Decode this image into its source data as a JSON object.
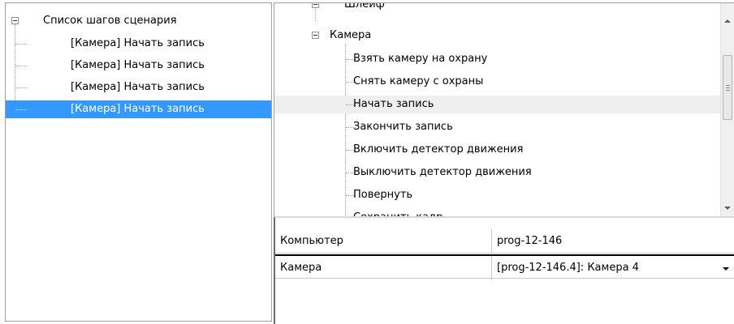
{
  "scenario_tree": {
    "root_label": "Список шагов сценария",
    "steps": [
      {
        "label": "[Камера] Начать запись",
        "selected": false
      },
      {
        "label": "[Камера] Начать запись",
        "selected": false
      },
      {
        "label": "[Камера] Начать запись",
        "selected": false
      },
      {
        "label": "[Камера] Начать запись",
        "selected": true
      }
    ]
  },
  "action_tree": {
    "partial_top_label": "Шлейф",
    "group_label": "Камера",
    "items": [
      {
        "label": "Взять камеру на охрану"
      },
      {
        "label": "Снять камеру с охраны"
      },
      {
        "label": "Начать запись",
        "highlighted": true
      },
      {
        "label": "Закончить запись"
      },
      {
        "label": "Включить детектор движения"
      },
      {
        "label": "Выключить детектор движения"
      },
      {
        "label": "Повернуть"
      },
      {
        "label": "Сохранить кадр"
      }
    ]
  },
  "property_grid": {
    "rows": [
      {
        "name": "Компьютер",
        "value": "prog-12-146"
      },
      {
        "name": "Камера",
        "value": "[prog-12-146.4]: Камера 4"
      }
    ]
  },
  "colors": {
    "selection": "#3399ff",
    "highlight_row": "#efefef"
  }
}
